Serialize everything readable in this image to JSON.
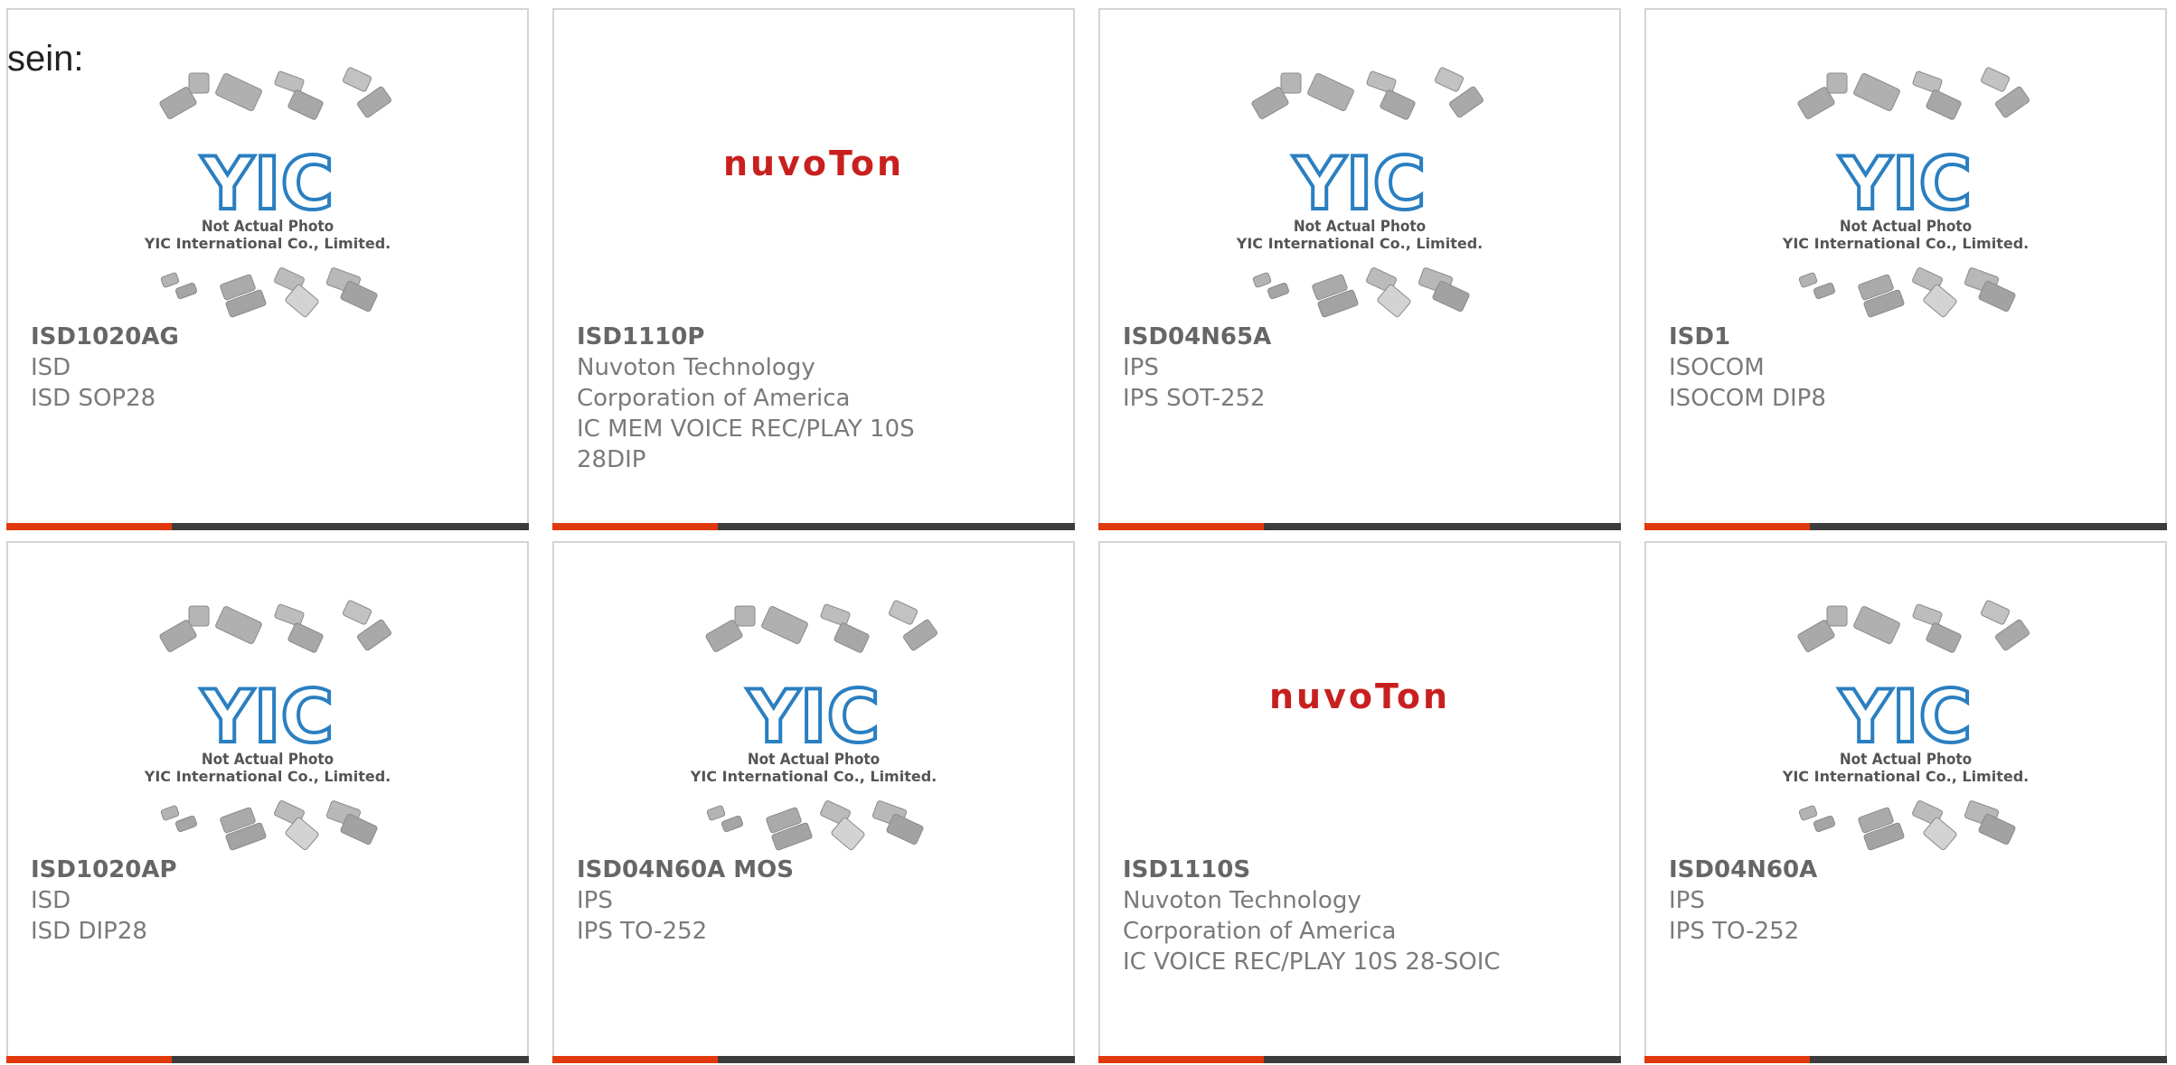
{
  "intro_text": "sein:",
  "yic_placeholder": {
    "logo": "YIC",
    "line1": "Not Actual Photo",
    "line2": "YIC International Co., Limited."
  },
  "nuvoton_logo": "nuvoTon",
  "products": [
    {
      "part": "ISD1020AG",
      "manufacturer": "ISD",
      "description": "ISD SOP28",
      "image": "yic"
    },
    {
      "part": "ISD1110P",
      "manufacturer": "Nuvoton Technology Corporation of America",
      "description": "IC MEM VOICE REC/PLAY 10S 28DIP",
      "image": "nuvoton"
    },
    {
      "part": "ISD04N65A",
      "manufacturer": "IPS",
      "description": "IPS SOT-252",
      "image": "yic"
    },
    {
      "part": "ISD1",
      "manufacturer": "ISOCOM",
      "description": "ISOCOM DIP8",
      "image": "yic"
    },
    {
      "part": "ISD1020AP",
      "manufacturer": "ISD",
      "description": "ISD DIP28",
      "image": "yic"
    },
    {
      "part": "ISD04N60A MOS",
      "manufacturer": "IPS",
      "description": "IPS TO-252",
      "image": "yic"
    },
    {
      "part": "ISD1110S",
      "manufacturer": "Nuvoton Technology Corporation of America",
      "description": "IC VOICE REC/PLAY 10S 28-SOIC",
      "image": "nuvoton"
    },
    {
      "part": "ISD04N60A",
      "manufacturer": "IPS",
      "description": "IPS TO-252",
      "image": "yic"
    }
  ],
  "colors": {
    "accent": "#e2380d",
    "bar": "#3c3c3c",
    "yic_blue": "#2a7fc1",
    "nuvoton_red": "#c8201f"
  }
}
